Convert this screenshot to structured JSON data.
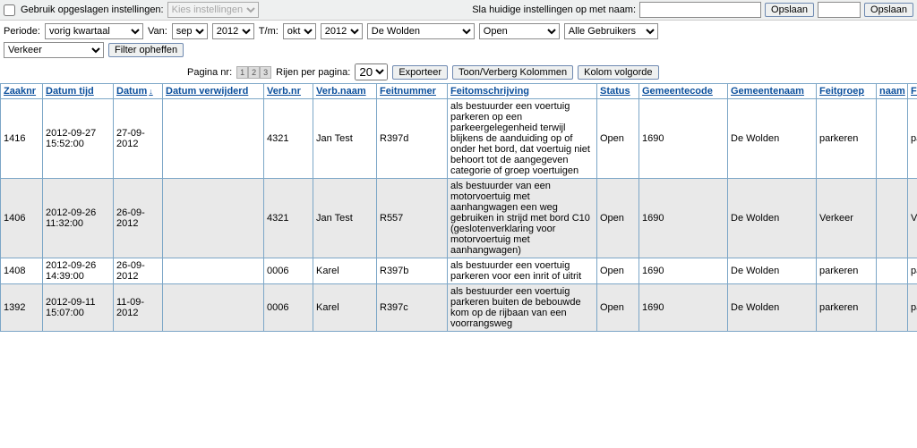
{
  "toolbar": {
    "use_saved_label": "Gebruik opgeslagen instellingen:",
    "use_saved_checked": false,
    "settings_placeholder": "Kies instellingen",
    "save_label_left": "Sla huidige instellingen op met naam:",
    "save_name_value": "",
    "save_btn": "Opslaan",
    "save_btn2": "Opslaan"
  },
  "filters": {
    "period_label": "Periode:",
    "period_value": "vorig kwartaal",
    "from_label": "Van:",
    "from_month": "sep",
    "from_year": "2012",
    "to_label": "T/m:",
    "to_month": "okt",
    "to_year": "2012",
    "municipality": "De Wolden",
    "status": "Open",
    "users": "Alle Gebruikers",
    "category": "Verkeer",
    "clear_btn": "Filter opheffen"
  },
  "pager": {
    "page_label": "Pagina nr:",
    "pages": [
      "1",
      "2",
      "3"
    ],
    "rows_label": "Rijen per pagina:",
    "rows_value": "20",
    "export_btn": "Exporteer",
    "toggle_cols_btn": "Toon/Verberg Kolommen",
    "col_order_btn": "Kolom volgorde"
  },
  "columns": [
    {
      "key": "zaaknr",
      "label": "Zaaknr"
    },
    {
      "key": "datumtijd",
      "label": "Datum tijd"
    },
    {
      "key": "datum",
      "label": "Datum",
      "sort": "↓"
    },
    {
      "key": "datum_verwijderd",
      "label": "Datum verwijderd"
    },
    {
      "key": "verbnr",
      "label": "Verb.nr"
    },
    {
      "key": "verbnaam",
      "label": "Verb.naam"
    },
    {
      "key": "feitnummer",
      "label": "Feitnummer"
    },
    {
      "key": "feitomschrijving",
      "label": "Feitomschrijving"
    },
    {
      "key": "status",
      "label": "Status"
    },
    {
      "key": "gemeentecode",
      "label": "Gemeentecode"
    },
    {
      "key": "gemeentenaam",
      "label": "Gemeentenaam"
    },
    {
      "key": "feitgroep",
      "label": "Feitgroep"
    },
    {
      "key": "naam",
      "label": "naam"
    },
    {
      "key": "feitgroep2",
      "label": "Feitgroep"
    }
  ],
  "rows": [
    {
      "zaaknr": "1416",
      "datumtijd": "2012-09-27 15:52:00",
      "datum": "27-09-2012",
      "datum_verwijderd": "",
      "verbnr": "4321",
      "verbnaam": "Jan Test",
      "feitnummer": "R397d",
      "feitomschrijving": "als bestuurder een voertuig parkeren op een parkeergelegenheid terwijl blijkens de aanduiding op of onder het bord, dat voertuig niet behoort tot de aangegeven categorie of groep voertuigen",
      "status": "Open",
      "gemeentecode": "1690",
      "gemeentenaam": "De Wolden",
      "feitgroep": "parkeren",
      "naam": "",
      "feitgroep2": "parkeren"
    },
    {
      "zaaknr": "1406",
      "datumtijd": "2012-09-26 11:32:00",
      "datum": "26-09-2012",
      "datum_verwijderd": "",
      "verbnr": "4321",
      "verbnaam": "Jan Test",
      "feitnummer": "R557",
      "feitomschrijving": "als bestuurder van een motorvoertuig met aanhangwagen een weg gebruiken in strijd met bord C10 (geslotenverklaring voor motorvoertuig met aanhangwagen)",
      "status": "Open",
      "gemeentecode": "1690",
      "gemeentenaam": "De Wolden",
      "feitgroep": "Verkeer",
      "naam": "",
      "feitgroep2": "Verkeer"
    },
    {
      "zaaknr": "1408",
      "datumtijd": "2012-09-26 14:39:00",
      "datum": "26-09-2012",
      "datum_verwijderd": "",
      "verbnr": "0006",
      "verbnaam": "Karel",
      "feitnummer": "R397b",
      "feitomschrijving": "als bestuurder een voertuig parkeren voor een inrit of uitrit",
      "status": "Open",
      "gemeentecode": "1690",
      "gemeentenaam": "De Wolden",
      "feitgroep": "parkeren",
      "naam": "",
      "feitgroep2": "parkeren"
    },
    {
      "zaaknr": "1392",
      "datumtijd": "2012-09-11 15:07:00",
      "datum": "11-09-2012",
      "datum_verwijderd": "",
      "verbnr": "0006",
      "verbnaam": "Karel",
      "feitnummer": "R397c",
      "feitomschrijving": "als bestuurder een voertuig parkeren buiten de bebouwde kom op de rijbaan van een voorrangsweg",
      "status": "Open",
      "gemeentecode": "1690",
      "gemeentenaam": "De Wolden",
      "feitgroep": "parkeren",
      "naam": "",
      "feitgroep2": "parkeren"
    }
  ],
  "col_widths": {
    "zaaknr": 40,
    "datumtijd": 72,
    "datum": 48,
    "datum_verwijderd": 106,
    "verbnr": 48,
    "verbnaam": 64,
    "feitnummer": 72,
    "feitomschrijving": 160,
    "status": 40,
    "gemeentecode": 92,
    "gemeentenaam": 92,
    "feitgroep": 60,
    "naam": 28,
    "feitgroep2": 60
  }
}
